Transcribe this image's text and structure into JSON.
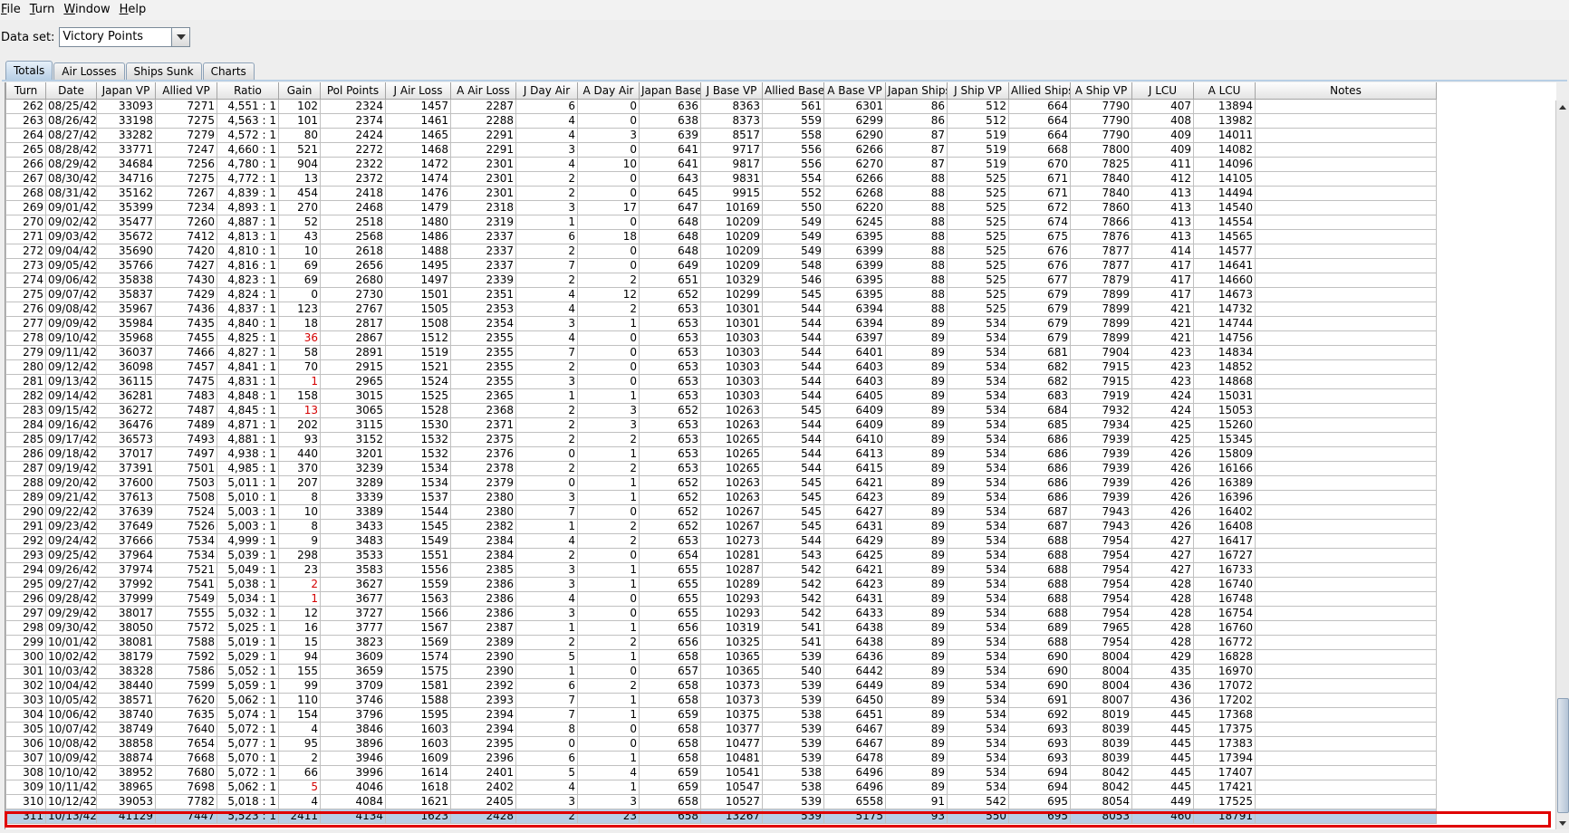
{
  "menubar": {
    "items": [
      {
        "mnemonic": "F",
        "rest": "ile"
      },
      {
        "mnemonic": "T",
        "rest": "urn"
      },
      {
        "mnemonic": "W",
        "rest": "indow"
      },
      {
        "mnemonic": "H",
        "rest": "elp"
      }
    ]
  },
  "dataset": {
    "label": "Data set:",
    "selected": "Victory Points"
  },
  "tabs": [
    "Totals",
    "Air Losses",
    "Ships Sunk",
    "Charts"
  ],
  "active_tab": "Totals",
  "table": {
    "columns": [
      "Turn",
      "Date",
      "Japan VP",
      "Allied VP",
      "Ratio",
      "Gain",
      "Pol Points",
      "J Air Loss",
      "A Air Loss",
      "J Day Air",
      "A Day Air",
      "Japan Base",
      "J Base VP",
      "Allied Base",
      "A Base VP",
      "Japan Ships",
      "J Ship VP",
      "Allied Ships",
      "A Ship VP",
      "J LCU",
      "A LCU",
      "Notes"
    ],
    "highlight_color": "#d40000",
    "selected_turn": "311",
    "rows": [
      [
        "262",
        "08/25/42",
        "33093",
        "7271",
        "4,551 : 1",
        "102",
        "2324",
        "1457",
        "2287",
        "6",
        "0",
        "636",
        "8363",
        "561",
        "6301",
        "86",
        "512",
        "664",
        "7790",
        "407",
        "13894",
        ""
      ],
      [
        "263",
        "08/26/42",
        "33198",
        "7275",
        "4,563 : 1",
        "101",
        "2374",
        "1461",
        "2288",
        "4",
        "0",
        "638",
        "8373",
        "559",
        "6299",
        "86",
        "512",
        "664",
        "7790",
        "408",
        "13982",
        ""
      ],
      [
        "264",
        "08/27/42",
        "33282",
        "7279",
        "4,572 : 1",
        "80",
        "2424",
        "1465",
        "2291",
        "4",
        "3",
        "639",
        "8517",
        "558",
        "6290",
        "87",
        "519",
        "664",
        "7790",
        "409",
        "14011",
        ""
      ],
      [
        "265",
        "08/28/42",
        "33771",
        "7247",
        "4,660 : 1",
        "521",
        "2272",
        "1468",
        "2291",
        "3",
        "0",
        "641",
        "9717",
        "556",
        "6266",
        "87",
        "519",
        "668",
        "7800",
        "409",
        "14082",
        ""
      ],
      [
        "266",
        "08/29/42",
        "34684",
        "7256",
        "4,780 : 1",
        "904",
        "2322",
        "1472",
        "2301",
        "4",
        "10",
        "641",
        "9817",
        "556",
        "6270",
        "87",
        "519",
        "670",
        "7825",
        "411",
        "14096",
        ""
      ],
      [
        "267",
        "08/30/42",
        "34716",
        "7275",
        "4,772 : 1",
        "13",
        "2372",
        "1474",
        "2301",
        "2",
        "0",
        "643",
        "9831",
        "554",
        "6266",
        "88",
        "525",
        "671",
        "7840",
        "412",
        "14105",
        ""
      ],
      [
        "268",
        "08/31/42",
        "35162",
        "7267",
        "4,839 : 1",
        "454",
        "2418",
        "1476",
        "2301",
        "2",
        "0",
        "645",
        "9915",
        "552",
        "6268",
        "88",
        "525",
        "671",
        "7840",
        "413",
        "14494",
        ""
      ],
      [
        "269",
        "09/01/42",
        "35399",
        "7234",
        "4,893 : 1",
        "270",
        "2468",
        "1479",
        "2318",
        "3",
        "17",
        "647",
        "10169",
        "550",
        "6220",
        "88",
        "525",
        "672",
        "7860",
        "413",
        "14540",
        ""
      ],
      [
        "270",
        "09/02/42",
        "35477",
        "7260",
        "4,887 : 1",
        "52",
        "2518",
        "1480",
        "2319",
        "1",
        "0",
        "648",
        "10209",
        "549",
        "6245",
        "88",
        "525",
        "674",
        "7866",
        "413",
        "14554",
        ""
      ],
      [
        "271",
        "09/03/42",
        "35672",
        "7412",
        "4,813 : 1",
        "43",
        "2568",
        "1486",
        "2337",
        "6",
        "18",
        "648",
        "10209",
        "549",
        "6395",
        "88",
        "525",
        "675",
        "7876",
        "413",
        "14565",
        ""
      ],
      [
        "272",
        "09/04/42",
        "35690",
        "7420",
        "4,810 : 1",
        "10",
        "2618",
        "1488",
        "2337",
        "2",
        "0",
        "648",
        "10209",
        "549",
        "6399",
        "88",
        "525",
        "676",
        "7877",
        "414",
        "14577",
        ""
      ],
      [
        "273",
        "09/05/42",
        "35766",
        "7427",
        "4,816 : 1",
        "69",
        "2656",
        "1495",
        "2337",
        "7",
        "0",
        "649",
        "10209",
        "548",
        "6399",
        "88",
        "525",
        "676",
        "7877",
        "417",
        "14641",
        ""
      ],
      [
        "274",
        "09/06/42",
        "35838",
        "7430",
        "4,823 : 1",
        "69",
        "2680",
        "1497",
        "2339",
        "2",
        "2",
        "651",
        "10329",
        "546",
        "6395",
        "88",
        "525",
        "677",
        "7879",
        "417",
        "14660",
        ""
      ],
      [
        "275",
        "09/07/42",
        "35837",
        "7429",
        "4,824 : 1",
        "0",
        "2730",
        "1501",
        "2351",
        "4",
        "12",
        "652",
        "10299",
        "545",
        "6395",
        "88",
        "525",
        "679",
        "7899",
        "417",
        "14673",
        ""
      ],
      [
        "276",
        "09/08/42",
        "35967",
        "7436",
        "4,837 : 1",
        "123",
        "2767",
        "1505",
        "2353",
        "4",
        "2",
        "653",
        "10301",
        "544",
        "6394",
        "88",
        "525",
        "679",
        "7899",
        "421",
        "14732",
        ""
      ],
      [
        "277",
        "09/09/42",
        "35984",
        "7435",
        "4,840 : 1",
        "18",
        "2817",
        "1508",
        "2354",
        "3",
        "1",
        "653",
        "10301",
        "544",
        "6394",
        "89",
        "534",
        "679",
        "7899",
        "421",
        "14744",
        ""
      ],
      [
        "278",
        "09/10/42",
        "35968",
        "7455",
        "4,825 : 1",
        "36",
        "2867",
        "1512",
        "2355",
        "4",
        "0",
        "653",
        "10303",
        "544",
        "6397",
        "89",
        "534",
        "679",
        "7899",
        "421",
        "14756",
        ""
      ],
      [
        "279",
        "09/11/42",
        "36037",
        "7466",
        "4,827 : 1",
        "58",
        "2891",
        "1519",
        "2355",
        "7",
        "0",
        "653",
        "10303",
        "544",
        "6401",
        "89",
        "534",
        "681",
        "7904",
        "423",
        "14834",
        ""
      ],
      [
        "280",
        "09/12/42",
        "36098",
        "7457",
        "4,841 : 1",
        "70",
        "2915",
        "1521",
        "2355",
        "2",
        "0",
        "653",
        "10303",
        "544",
        "6403",
        "89",
        "534",
        "682",
        "7915",
        "423",
        "14852",
        ""
      ],
      [
        "281",
        "09/13/42",
        "36115",
        "7475",
        "4,831 : 1",
        "1",
        "2965",
        "1524",
        "2355",
        "3",
        "0",
        "653",
        "10303",
        "544",
        "6403",
        "89",
        "534",
        "682",
        "7915",
        "423",
        "14868",
        ""
      ],
      [
        "282",
        "09/14/42",
        "36281",
        "7483",
        "4,848 : 1",
        "158",
        "3015",
        "1525",
        "2365",
        "1",
        "1",
        "653",
        "10303",
        "544",
        "6405",
        "89",
        "534",
        "683",
        "7919",
        "424",
        "15031",
        ""
      ],
      [
        "283",
        "09/15/42",
        "36272",
        "7487",
        "4,845 : 1",
        "13",
        "3065",
        "1528",
        "2368",
        "2",
        "3",
        "652",
        "10263",
        "545",
        "6409",
        "89",
        "534",
        "684",
        "7932",
        "424",
        "15053",
        ""
      ],
      [
        "284",
        "09/16/42",
        "36476",
        "7489",
        "4,871 : 1",
        "202",
        "3115",
        "1530",
        "2371",
        "2",
        "3",
        "653",
        "10263",
        "544",
        "6409",
        "89",
        "534",
        "685",
        "7934",
        "425",
        "15260",
        ""
      ],
      [
        "285",
        "09/17/42",
        "36573",
        "7493",
        "4,881 : 1",
        "93",
        "3152",
        "1532",
        "2375",
        "2",
        "2",
        "653",
        "10265",
        "544",
        "6410",
        "89",
        "534",
        "686",
        "7939",
        "425",
        "15345",
        ""
      ],
      [
        "286",
        "09/18/42",
        "37017",
        "7497",
        "4,938 : 1",
        "440",
        "3201",
        "1532",
        "2376",
        "0",
        "1",
        "653",
        "10265",
        "544",
        "6413",
        "89",
        "534",
        "686",
        "7939",
        "426",
        "15809",
        ""
      ],
      [
        "287",
        "09/19/42",
        "37391",
        "7501",
        "4,985 : 1",
        "370",
        "3239",
        "1534",
        "2378",
        "2",
        "2",
        "653",
        "10265",
        "544",
        "6415",
        "89",
        "534",
        "686",
        "7939",
        "426",
        "16166",
        ""
      ],
      [
        "288",
        "09/20/42",
        "37600",
        "7503",
        "5,011 : 1",
        "207",
        "3289",
        "1534",
        "2379",
        "0",
        "1",
        "652",
        "10263",
        "545",
        "6421",
        "89",
        "534",
        "686",
        "7939",
        "426",
        "16389",
        ""
      ],
      [
        "289",
        "09/21/42",
        "37613",
        "7508",
        "5,010 : 1",
        "8",
        "3339",
        "1537",
        "2380",
        "3",
        "1",
        "652",
        "10263",
        "545",
        "6423",
        "89",
        "534",
        "686",
        "7939",
        "426",
        "16396",
        ""
      ],
      [
        "290",
        "09/22/42",
        "37639",
        "7524",
        "5,003 : 1",
        "10",
        "3389",
        "1544",
        "2380",
        "7",
        "0",
        "652",
        "10267",
        "545",
        "6427",
        "89",
        "534",
        "687",
        "7943",
        "426",
        "16402",
        ""
      ],
      [
        "291",
        "09/23/42",
        "37649",
        "7526",
        "5,003 : 1",
        "8",
        "3433",
        "1545",
        "2382",
        "1",
        "2",
        "652",
        "10267",
        "545",
        "6431",
        "89",
        "534",
        "687",
        "7943",
        "426",
        "16408",
        ""
      ],
      [
        "292",
        "09/24/42",
        "37666",
        "7534",
        "4,999 : 1",
        "9",
        "3483",
        "1549",
        "2384",
        "4",
        "2",
        "653",
        "10273",
        "544",
        "6429",
        "89",
        "534",
        "688",
        "7954",
        "427",
        "16417",
        ""
      ],
      [
        "293",
        "09/25/42",
        "37964",
        "7534",
        "5,039 : 1",
        "298",
        "3533",
        "1551",
        "2384",
        "2",
        "0",
        "654",
        "10281",
        "543",
        "6425",
        "89",
        "534",
        "688",
        "7954",
        "427",
        "16727",
        ""
      ],
      [
        "294",
        "09/26/42",
        "37974",
        "7521",
        "5,049 : 1",
        "23",
        "3583",
        "1556",
        "2385",
        "3",
        "1",
        "655",
        "10287",
        "542",
        "6421",
        "89",
        "534",
        "688",
        "7954",
        "427",
        "16733",
        ""
      ],
      [
        "295",
        "09/27/42",
        "37992",
        "7541",
        "5,038 : 1",
        "2",
        "3627",
        "1559",
        "2386",
        "3",
        "1",
        "655",
        "10289",
        "542",
        "6423",
        "89",
        "534",
        "688",
        "7954",
        "428",
        "16740",
        ""
      ],
      [
        "296",
        "09/28/42",
        "37999",
        "7549",
        "5,034 : 1",
        "1",
        "3677",
        "1563",
        "2386",
        "4",
        "0",
        "655",
        "10293",
        "542",
        "6431",
        "89",
        "534",
        "688",
        "7954",
        "428",
        "16748",
        ""
      ],
      [
        "297",
        "09/29/42",
        "38017",
        "7555",
        "5,032 : 1",
        "12",
        "3727",
        "1566",
        "2386",
        "3",
        "0",
        "655",
        "10293",
        "542",
        "6433",
        "89",
        "534",
        "688",
        "7954",
        "428",
        "16754",
        ""
      ],
      [
        "298",
        "09/30/42",
        "38050",
        "7572",
        "5,025 : 1",
        "16",
        "3777",
        "1567",
        "2387",
        "1",
        "1",
        "656",
        "10319",
        "541",
        "6438",
        "89",
        "534",
        "689",
        "7965",
        "428",
        "16760",
        ""
      ],
      [
        "299",
        "10/01/42",
        "38081",
        "7588",
        "5,019 : 1",
        "15",
        "3823",
        "1569",
        "2389",
        "2",
        "2",
        "656",
        "10325",
        "541",
        "6438",
        "89",
        "534",
        "688",
        "7954",
        "428",
        "16772",
        ""
      ],
      [
        "300",
        "10/02/42",
        "38179",
        "7592",
        "5,029 : 1",
        "94",
        "3609",
        "1574",
        "2390",
        "5",
        "1",
        "658",
        "10365",
        "539",
        "6436",
        "89",
        "534",
        "690",
        "8004",
        "429",
        "16828",
        ""
      ],
      [
        "301",
        "10/03/42",
        "38328",
        "7586",
        "5,052 : 1",
        "155",
        "3659",
        "1575",
        "2390",
        "1",
        "0",
        "657",
        "10365",
        "540",
        "6442",
        "89",
        "534",
        "690",
        "8004",
        "435",
        "16970",
        ""
      ],
      [
        "302",
        "10/04/42",
        "38440",
        "7599",
        "5,059 : 1",
        "99",
        "3709",
        "1581",
        "2392",
        "6",
        "2",
        "658",
        "10373",
        "539",
        "6449",
        "89",
        "534",
        "690",
        "8004",
        "436",
        "17072",
        ""
      ],
      [
        "303",
        "10/05/42",
        "38571",
        "7620",
        "5,062 : 1",
        "110",
        "3746",
        "1588",
        "2393",
        "7",
        "1",
        "658",
        "10373",
        "539",
        "6450",
        "89",
        "534",
        "691",
        "8007",
        "436",
        "17202",
        ""
      ],
      [
        "304",
        "10/06/42",
        "38740",
        "7635",
        "5,074 : 1",
        "154",
        "3796",
        "1595",
        "2394",
        "7",
        "1",
        "659",
        "10375",
        "538",
        "6451",
        "89",
        "534",
        "692",
        "8019",
        "445",
        "17368",
        ""
      ],
      [
        "305",
        "10/07/42",
        "38749",
        "7640",
        "5,072 : 1",
        "4",
        "3846",
        "1603",
        "2394",
        "8",
        "0",
        "658",
        "10377",
        "539",
        "6467",
        "89",
        "534",
        "693",
        "8039",
        "445",
        "17375",
        ""
      ],
      [
        "306",
        "10/08/42",
        "38858",
        "7654",
        "5,077 : 1",
        "95",
        "3896",
        "1603",
        "2395",
        "0",
        "0",
        "658",
        "10477",
        "539",
        "6467",
        "89",
        "534",
        "693",
        "8039",
        "445",
        "17383",
        ""
      ],
      [
        "307",
        "10/09/42",
        "38874",
        "7668",
        "5,070 : 1",
        "2",
        "3946",
        "1609",
        "2396",
        "6",
        "1",
        "658",
        "10481",
        "539",
        "6478",
        "89",
        "534",
        "693",
        "8039",
        "445",
        "17394",
        ""
      ],
      [
        "308",
        "10/10/42",
        "38952",
        "7680",
        "5,072 : 1",
        "66",
        "3996",
        "1614",
        "2401",
        "5",
        "4",
        "659",
        "10541",
        "538",
        "6496",
        "89",
        "534",
        "694",
        "8042",
        "445",
        "17407",
        ""
      ],
      [
        "309",
        "10/11/42",
        "38965",
        "7698",
        "5,062 : 1",
        "5",
        "4046",
        "1618",
        "2402",
        "4",
        "1",
        "659",
        "10547",
        "538",
        "6496",
        "89",
        "534",
        "694",
        "8042",
        "445",
        "17421",
        ""
      ],
      [
        "310",
        "10/12/42",
        "39053",
        "7782",
        "5,018 : 1",
        "4",
        "4084",
        "1621",
        "2405",
        "3",
        "3",
        "658",
        "10527",
        "539",
        "6558",
        "91",
        "542",
        "695",
        "8054",
        "449",
        "17525",
        ""
      ],
      [
        "311",
        "10/13/42",
        "41129",
        "7447",
        "5,523 : 1",
        "2411",
        "4134",
        "1623",
        "2428",
        "2",
        "23",
        "658",
        "13267",
        "539",
        "5175",
        "93",
        "550",
        "695",
        "8053",
        "460",
        "18791",
        ""
      ]
    ],
    "red_gain_turns": [
      "278",
      "281",
      "283",
      "295",
      "296",
      "309"
    ]
  },
  "icons": {
    "combo_arrow": "triangle-down-icon",
    "scroll_up": "triangle-up-icon",
    "scroll_down": "triangle-down-icon"
  }
}
